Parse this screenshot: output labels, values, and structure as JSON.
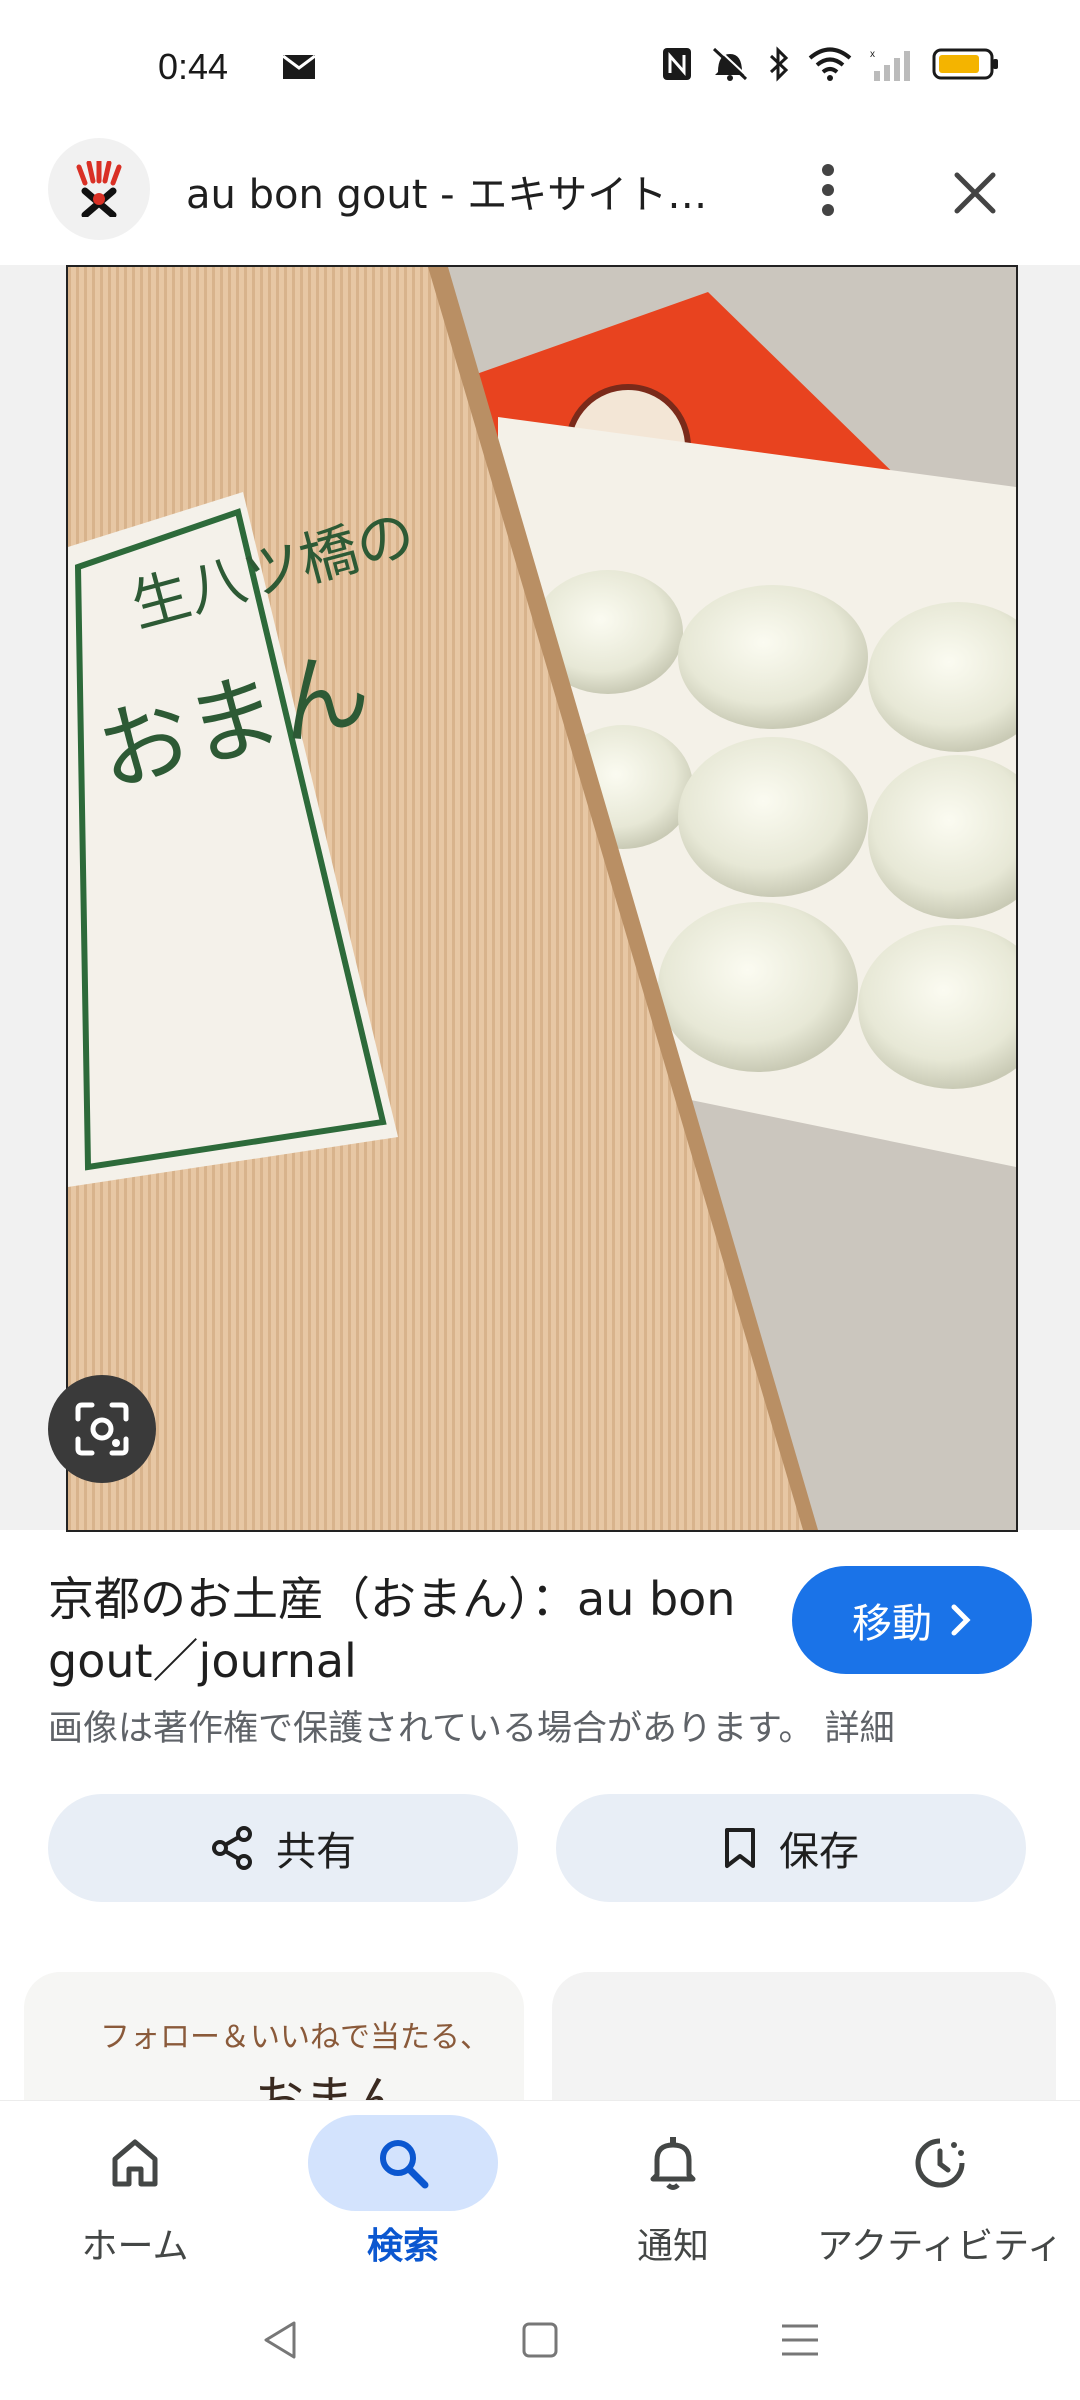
{
  "status_bar": {
    "time": "0:44",
    "battery_color": "#f4b400"
  },
  "header": {
    "title": "au bon gout - エキサイト…"
  },
  "result": {
    "title": "京都のお土産（おまん）：au bon gout／journal",
    "visit_label": "移動",
    "copyright_notice": "画像は著作権で保護されている場合があります。 詳細"
  },
  "photo": {
    "box_label_line1": "生八ツ橋の",
    "box_label_line2": "おまん"
  },
  "actions": {
    "share_label": "共有",
    "save_label": "保存"
  },
  "related": {
    "thumb1_text": "フォロー＆いいねで当たる、",
    "thumb1_big": "おまん"
  },
  "bottom_nav": {
    "home": "ホーム",
    "search": "検索",
    "notifications": "通知",
    "activity": "アクティビティ"
  },
  "colors": {
    "accent": "#1a73e8",
    "active_nav": "#0b57d0",
    "active_nav_bg": "#d3e3fd",
    "pill_bg": "#e8eef6"
  }
}
